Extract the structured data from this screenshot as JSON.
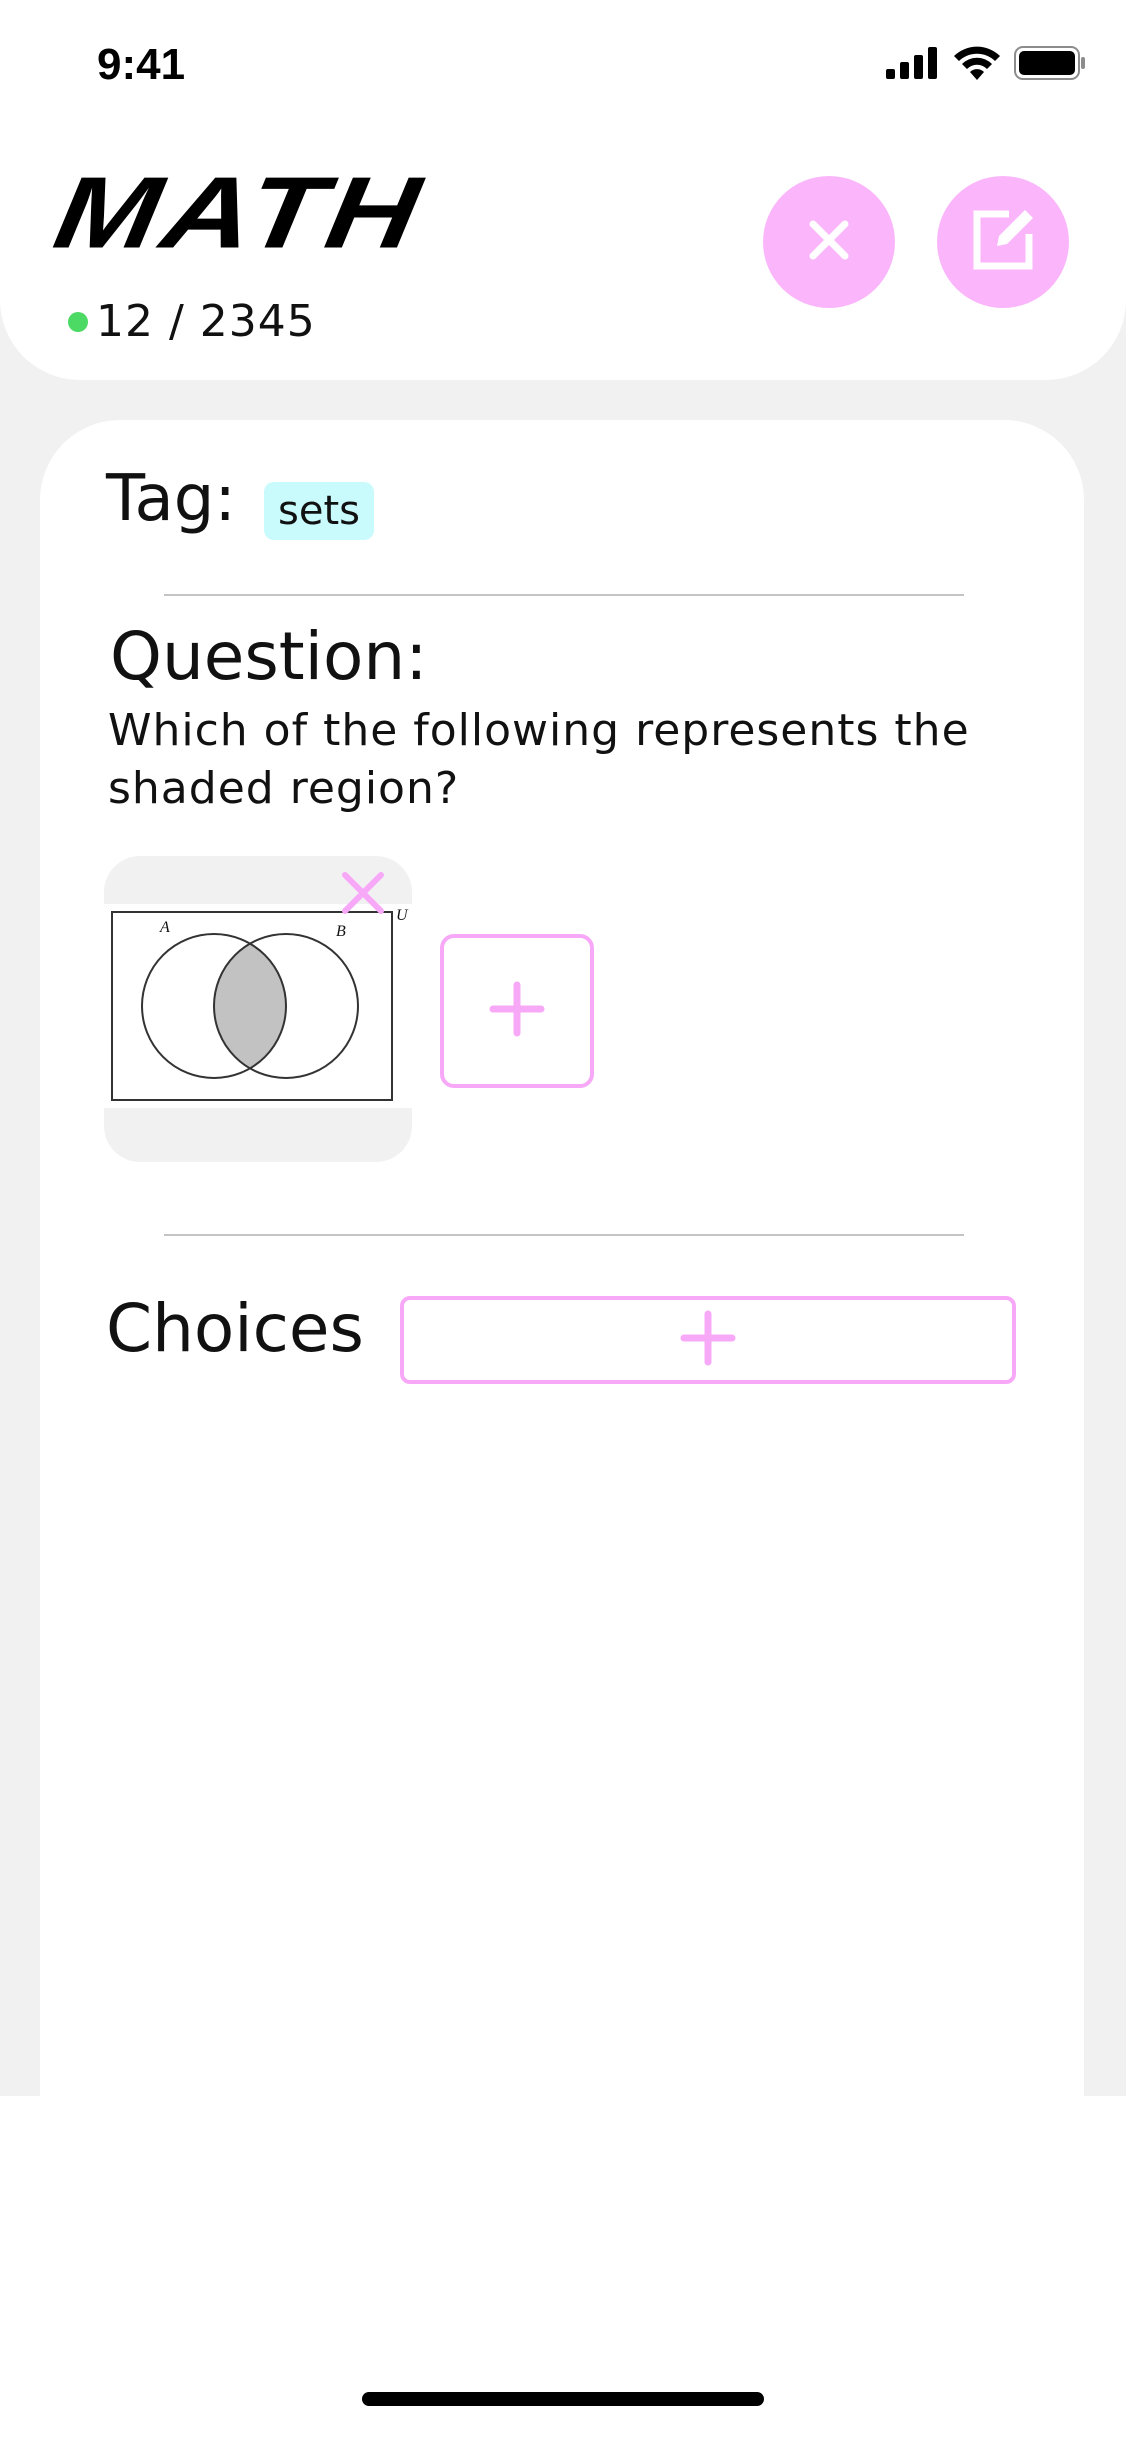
{
  "status_bar": {
    "time": "9:41",
    "icons": [
      "cellular-signal-icon",
      "wifi-icon",
      "battery-icon"
    ]
  },
  "header": {
    "title": "MATH",
    "progress": "12 / 2345",
    "status_dot_color": "#4cd964",
    "close_icon": "close-icon",
    "edit_icon": "edit-icon"
  },
  "card": {
    "tag_label": "Tag:",
    "tag_value": "sets",
    "question_label": "Question:",
    "question_text": "Which of the following represents the\n shaded region?",
    "image": {
      "description_icon": "venn-diagram-image",
      "set_a": "A",
      "set_b": "B",
      "universe": "U"
    },
    "choices_label": "Choices"
  },
  "colors": {
    "accent_pink": "#fbb6fb",
    "accent_pink_stroke": "#f7a8f7",
    "chip_bg": "#c9fbfd",
    "backdrop": "#f1f1f1"
  }
}
